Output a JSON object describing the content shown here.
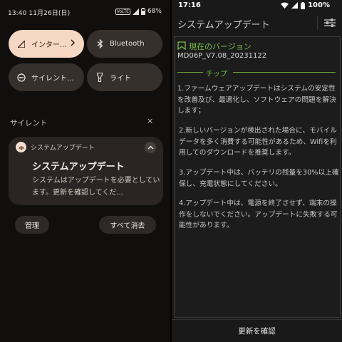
{
  "left": {
    "status_bar": {
      "time_date": "13:40 11月26日(日)",
      "volte": "VoLTE",
      "battery": "68%"
    },
    "tiles": {
      "network_label": "インター...",
      "bluetooth_label": "Bluetooth",
      "silent_label": "サイレント...",
      "light_label": "ライト"
    },
    "section": {
      "label": "サイレント",
      "close_glyph": "×"
    },
    "notification": {
      "app_name": "システムアップデート",
      "title": "システムアップデート",
      "body": "システムはアップデートを必要としています。更新を確認してくだ..."
    },
    "buttons": {
      "manage": "管理",
      "clear_all": "すべて消去"
    }
  },
  "right": {
    "status_bar": {
      "time": "17:16",
      "battery": "100%"
    },
    "title": "システムアップデート",
    "version_label": "現在のバージョン",
    "version_value": "MD06P_V7.08_20231122",
    "tip_label": "チップ",
    "paragraphs": [
      "1.ファームウェアアップデートはシステムの安定性を改善及び、最適化し、ソフトウェアの問題を解決します；",
      "2.新しいバージョンが検出された場合に、モバイルデータを多く消費する可能性があるため、Wifiを利用してのダウンロードを推奨します。",
      "3.アップデート中は、バッテリの残量を30%以上確保し、充電状態にしてください。",
      "4.アップデート中は、電源を終了させず、端末の操作をしないでください。アップデートに失敗する可能性があります。"
    ],
    "check_button": "更新を確認"
  },
  "colors": {
    "accent_green": "#76c043",
    "tile_active": "#f6d7c4",
    "tile_inactive": "#36302c"
  }
}
